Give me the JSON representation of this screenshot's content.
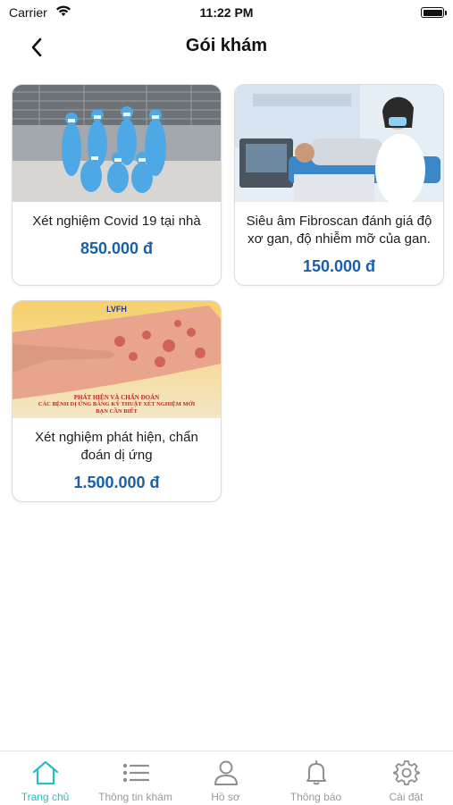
{
  "status_bar": {
    "carrier": "Carrier",
    "time": "11:22 PM"
  },
  "header": {
    "title": "Gói khám"
  },
  "packages": [
    {
      "title": "Xét nghiệm Covid 19 tại nhà",
      "price": "850.000 đ",
      "image": "covid-team-photo"
    },
    {
      "title": "Siêu âm Fibroscan đánh giá độ xơ gan, độ nhiễm mỡ của gan.",
      "price": "150.000 đ",
      "image": "fibroscan-photo"
    },
    {
      "title": "Xét nghiệm phát hiện, chẩn đoán dị ứng",
      "price": "1.500.000 đ",
      "image": "allergy-banner",
      "image_text": {
        "brand": "LVFH",
        "line1": "PHÁT HIỆN VÀ CHẨN ĐOÁN",
        "line2": "CÁC BỆNH DỊ ỨNG BẰNG KỸ THUẬT XÉT NGHIỆM MỚI",
        "line3": "BẠN CẦN BIẾT"
      }
    }
  ],
  "tabs": [
    {
      "label": "Trang chủ",
      "icon": "home-icon",
      "active": true
    },
    {
      "label": "Thông tin khám",
      "icon": "list-icon",
      "active": false
    },
    {
      "label": "Hồ sơ",
      "icon": "person-icon",
      "active": false
    },
    {
      "label": "Thông báo",
      "icon": "bell-icon",
      "active": false
    },
    {
      "label": "Cài đặt",
      "icon": "gear-icon",
      "active": false
    }
  ],
  "colors": {
    "accent": "#2bbcc4",
    "price": "#1b5fa6",
    "inactive": "#9a9a9a"
  }
}
